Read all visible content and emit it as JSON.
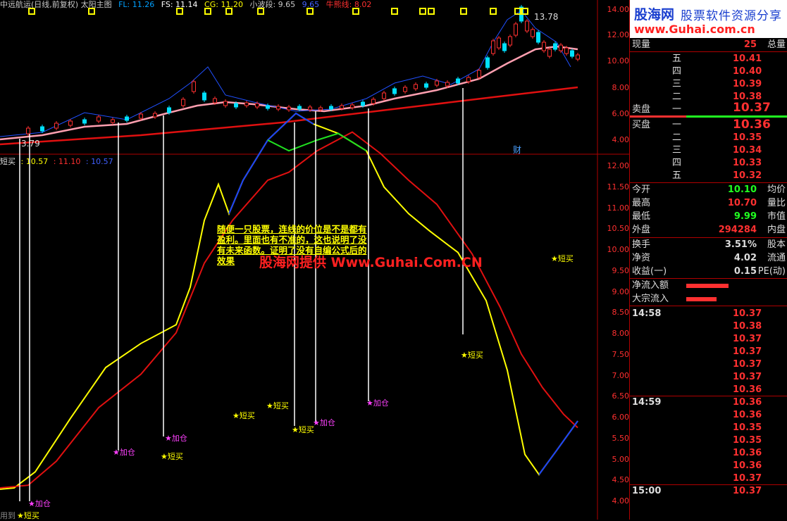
{
  "header": {
    "title": "中远航运(日线,前复权) 太阳主图",
    "fl": "FL: 11.26",
    "fs": "FS: 11.14",
    "cg": "CG: 11.20",
    "xbd": "小波段: 9.65",
    "xbd2": "9.65",
    "nxx": "牛熊线: 8.02"
  },
  "price_panel": {
    "high_label": "13.78",
    "low_label": "3.79",
    "cai_label": "财",
    "axis": [
      "14.00",
      "12.00",
      "10.00",
      "8.00",
      "6.00",
      "4.00"
    ]
  },
  "indicator": {
    "name": "短买",
    "v1": ": 10.57",
    "v2": ": 11.10",
    "v3": ": 10.57",
    "axis": [
      "12.00",
      "11.50",
      "11.00",
      "10.50",
      "10.00",
      "9.50",
      "9.00",
      "8.50",
      "8.00",
      "7.50",
      "7.00",
      "6.50",
      "6.00",
      "5.50",
      "5.00",
      "4.50",
      "4.00"
    ]
  },
  "annotation": "随便一只股票，连线的价位是不是都有盈利。里面也有不准的，这也说明了没有未来函数。证明了没有自编公式后的效果",
  "watermark": "股海网提供 Www.Guhai.Com.CN",
  "signals": [
    {
      "t": "★短买",
      "c": "b"
    },
    {
      "t": "★加仓",
      "c": "a"
    },
    {
      "t": "★加仓",
      "c": "a"
    },
    {
      "t": "★短买",
      "c": "b"
    },
    {
      "t": "★加仓",
      "c": "a"
    },
    {
      "t": "★短买",
      "c": "b"
    },
    {
      "t": "★短买",
      "c": "b"
    },
    {
      "t": "★短买",
      "c": "b"
    },
    {
      "t": "★加仓",
      "c": "a"
    },
    {
      "t": "★加仓",
      "c": "a"
    },
    {
      "t": "★短买",
      "c": "b"
    },
    {
      "t": "★短买",
      "c": "b"
    }
  ],
  "footer": "用到",
  "panel": {
    "logo1": "股海网",
    "logo2": "股票软件资源分享",
    "logo3": "www.Guhai.com.cn",
    "xianliang": {
      "k": "现量",
      "v": "25",
      "k2": "总量"
    },
    "sell": [
      {
        "lv": "五",
        "pr": "10.41"
      },
      {
        "lv": "四",
        "pr": "10.40"
      },
      {
        "lv": "三",
        "pr": "10.39"
      },
      {
        "lv": "二",
        "pr": "10.38"
      },
      {
        "lv": "一",
        "pr": "10.37"
      }
    ],
    "sell_label": "卖盘",
    "buy_label": "买盘",
    "buy": [
      {
        "lv": "一",
        "pr": "10.36"
      },
      {
        "lv": "二",
        "pr": "10.35"
      },
      {
        "lv": "三",
        "pr": "10.34"
      },
      {
        "lv": "四",
        "pr": "10.33"
      },
      {
        "lv": "五",
        "pr": "10.32"
      }
    ],
    "stats1": [
      {
        "k": "今开",
        "v": "10.10",
        "k2": "均价",
        "c": "#20ff20"
      },
      {
        "k": "最高",
        "v": "10.70",
        "k2": "量比",
        "c": "#ff3030"
      },
      {
        "k": "最低",
        "v": "9.99",
        "k2": "市值",
        "c": "#20ff20"
      },
      {
        "k": "外盘",
        "v": "294284",
        "k2": "内盘",
        "c": "#ff3030"
      }
    ],
    "stats2": [
      {
        "k": "换手",
        "v": "3.51%",
        "k2": "股本",
        "c": "#ddd"
      },
      {
        "k": "净资",
        "v": "4.02",
        "k2": "流通",
        "c": "#ddd"
      },
      {
        "k": "收益(一)",
        "v": "0.15",
        "k2": "PE(动)",
        "c": "#ddd"
      }
    ],
    "flows": [
      {
        "k": "净流入额",
        "w": 0.85
      },
      {
        "k": "大宗流入",
        "w": 0.62
      }
    ],
    "ticks": [
      {
        "t": "14:58",
        "p": [
          "10.37",
          "10.38",
          "10.37",
          "10.37",
          "10.37",
          "10.37",
          "10.36"
        ]
      },
      {
        "t": "14:59",
        "p": [
          "10.36",
          "10.36",
          "10.35",
          "10.35",
          "10.36",
          "10.36",
          "10.37"
        ]
      },
      {
        "t": "15:00",
        "p": [
          "10.37"
        ]
      }
    ],
    "colors": {
      "red": "#ff3030",
      "green": "#20ff20",
      "border": "#b00000"
    }
  }
}
